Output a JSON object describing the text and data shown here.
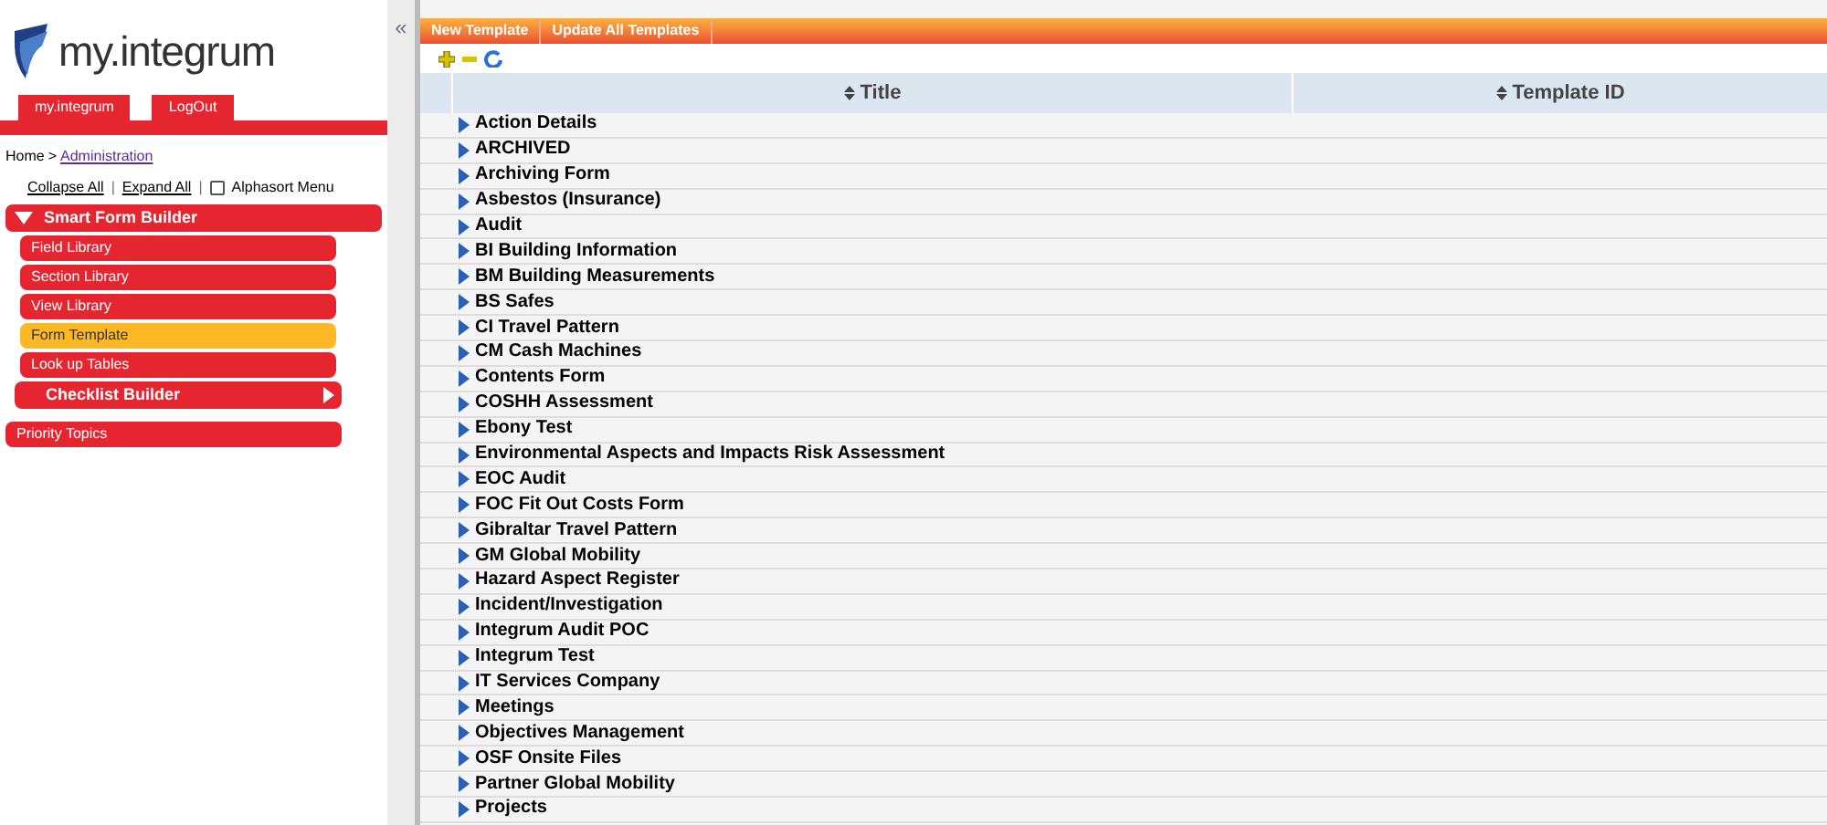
{
  "logo": {
    "text": "my.integrum"
  },
  "nav_tabs": [
    {
      "label": "my.integrum"
    },
    {
      "label": "LogOut"
    }
  ],
  "breadcrumb": {
    "home": "Home",
    "separator": ">",
    "link": "Administration"
  },
  "menu_actions": {
    "collapse": "Collapse All",
    "separator": "|",
    "expand": "Expand All",
    "alphasort": {
      "label": "Alphasort Menu",
      "checked": false
    }
  },
  "sidebar": {
    "items": [
      {
        "label": "Smart Form Builder",
        "kind": "group",
        "expanded": true,
        "children": [
          {
            "label": "Field Library",
            "selected": false
          },
          {
            "label": "Section Library",
            "selected": false
          },
          {
            "label": "View Library",
            "selected": false
          },
          {
            "label": "Form Template",
            "selected": true
          },
          {
            "label": "Look up Tables",
            "selected": false
          },
          {
            "label": "Checklist Builder",
            "kind": "subgroup",
            "expanded": false
          }
        ]
      },
      {
        "label": "Priority Topics",
        "kind": "item"
      }
    ]
  },
  "collapse_toggle": "«",
  "toolbar": {
    "buttons": [
      "New Template",
      "Update All Templates"
    ]
  },
  "table": {
    "columns": [
      "Title",
      "Template ID"
    ],
    "rows": [
      "Action Details",
      "ARCHIVED",
      "Archiving Form",
      "Asbestos (Insurance)",
      "Audit",
      "BI Building Information",
      "BM Building Measurements",
      "BS Safes",
      "CI Travel Pattern",
      "CM Cash Machines",
      "Contents Form",
      "COSHH Assessment",
      "Ebony Test",
      "Environmental Aspects and Impacts Risk Assessment",
      "EOC Audit",
      "FOC Fit Out Costs Form",
      "Gibraltar Travel Pattern",
      "GM Global Mobility",
      "Hazard Aspect Register",
      "Incident/Investigation",
      "Integrum Audit POC",
      "Integrum Test",
      "IT Services Company",
      "Meetings",
      "Objectives Management",
      "OSF Onsite Files",
      "Partner Global Mobility",
      "Projects"
    ]
  }
}
